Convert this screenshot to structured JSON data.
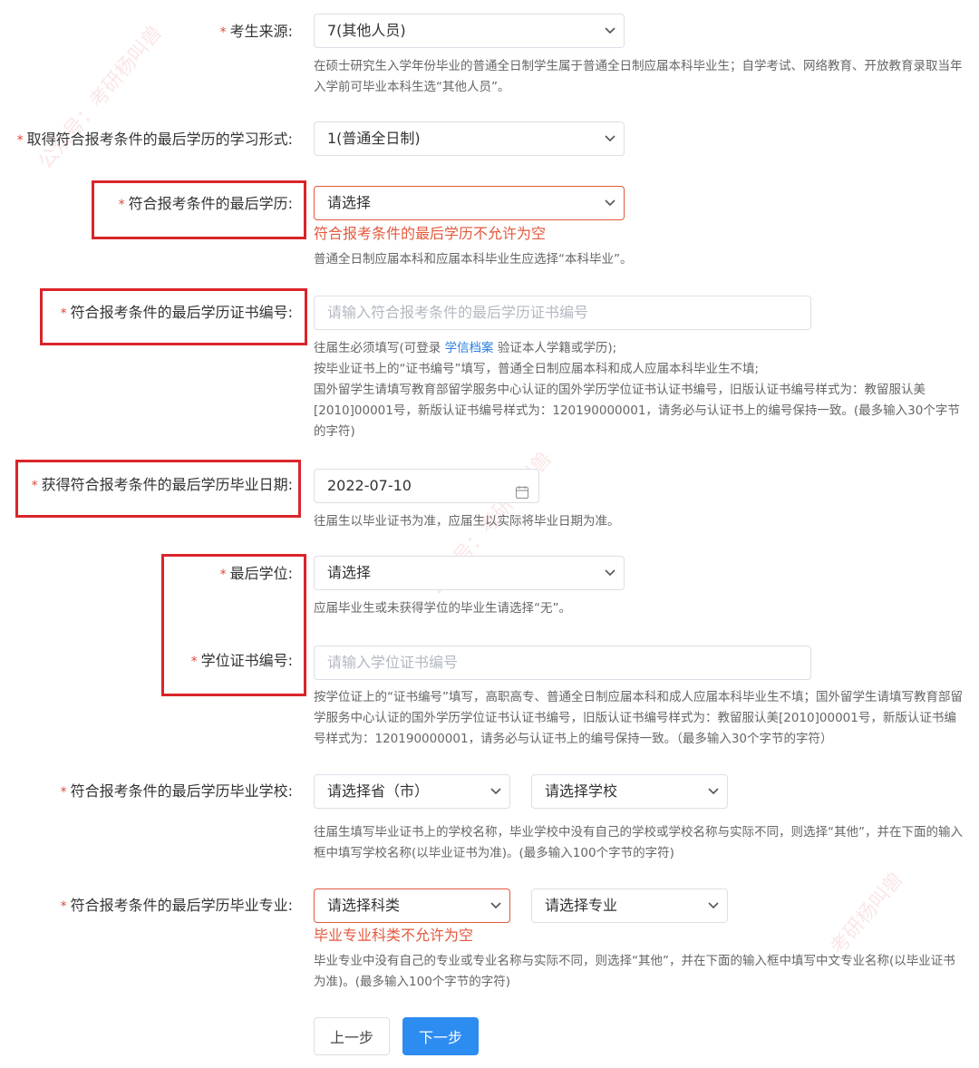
{
  "fields": {
    "source": {
      "label": "考生来源:",
      "value": "7(其他人员)",
      "hint": "在硕士研究生入学年份毕业的普通全日制学生属于普通全日制应届本科毕业生；自学考试、网络教育、开放教育录取当年入学前可毕业本科生选“其他人员”。"
    },
    "study_form": {
      "label": "取得符合报考条件的最后学历的学习形式:",
      "value": "1(普通全日制)"
    },
    "last_edu": {
      "label": "符合报考条件的最后学历:",
      "value": "请选择",
      "error": "符合报考条件的最后学历不允许为空",
      "hint": "普通全日制应届本科和应届本科毕业生应选择“本科毕业”。"
    },
    "cert_no": {
      "label": "符合报考条件的最后学历证书编号:",
      "placeholder": "请输入符合报考条件的最后学历证书编号",
      "hint_line1_pre": "往届生必须填写(可登录 ",
      "hint_link": "学信档案",
      "hint_line1_post": " 验证本人学籍或学历);",
      "hint_line2": "按毕业证书上的“证书编号”填写，普通全日制应届本科和成人应届本科毕业生不填;",
      "hint_line3": "国外留学生请填写教育部留学服务中心认证的国外学历学位证书认证书编号，旧版认证书编号样式为：教留服认美[2010]00001号，新版认证书编号样式为：120190000001，请务必与认证书上的编号保持一致。(最多输入30个字节的字符)"
    },
    "grad_date": {
      "label": "获得符合报考条件的最后学历毕业日期:",
      "value": "2022-07-10",
      "hint": "往届生以毕业证书为准，应届生以实际将毕业日期为准。"
    },
    "degree": {
      "label": "最后学位:",
      "value": "请选择",
      "hint": "应届毕业生或未获得学位的毕业生请选择“无”。"
    },
    "degree_cert": {
      "label": "学位证书编号:",
      "placeholder": "请输入学位证书编号",
      "hint": "按学位证上的“证书编号”填写，高职高专、普通全日制应届本科和成人应届本科毕业生不填；国外留学生请填写教育部留学服务中心认证的国外学历学位证书认证书编号，旧版认证书编号样式为：教留服认美[2010]00001号，新版认证书编号样式为：120190000001，请务必与认证书上的编号保持一致。（最多输入30个字节的字符）"
    },
    "grad_school": {
      "label": "符合报考条件的最后学历毕业学校:",
      "province": "请选择省（市）",
      "school": "请选择学校",
      "hint": "往届生填写毕业证书上的学校名称，毕业学校中没有自己的学校或学校名称与实际不同，则选择“其他”，并在下面的输入框中填写学校名称(以毕业证书为准)。(最多输入100个字节的字符)"
    },
    "grad_major": {
      "label": "符合报考条件的最后学历毕业专业:",
      "category": "请选择科类",
      "major": "请选择专业",
      "error": "毕业专业科类不允许为空",
      "hint": "毕业专业中没有自己的专业或专业名称与实际不同，则选择“其他”，并在下面的输入框中填写中文专业名称(以毕业证书为准)。(最多输入100个字节的字符)"
    }
  },
  "required_mark": "*",
  "buttons": {
    "prev": "上一步",
    "next": "下一步"
  },
  "watermark": {
    "text1": "公众号：考研杨叫兽",
    "text2": "考研杨叫兽"
  },
  "colors": {
    "required": "#e0463b",
    "error": "#e4593d",
    "primary": "#2d8cf0",
    "highlight_box": "#d9252b",
    "link": "#2b7fe0"
  }
}
